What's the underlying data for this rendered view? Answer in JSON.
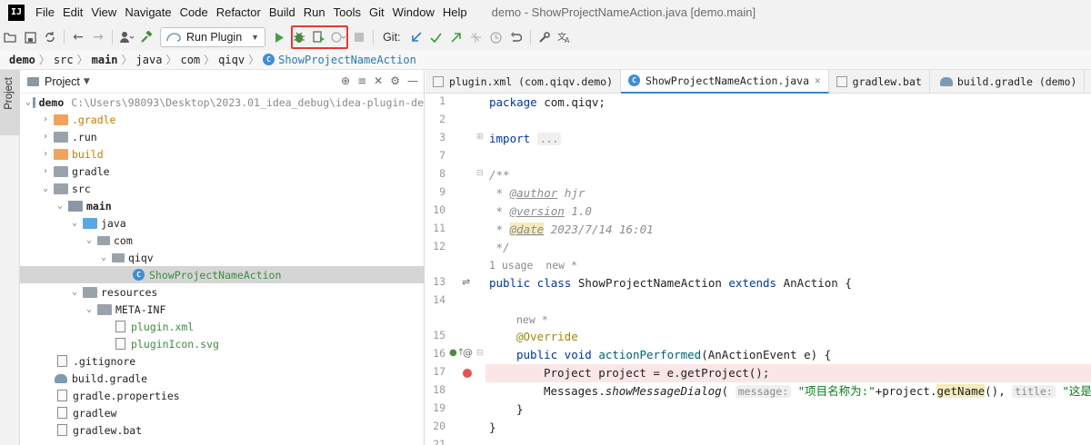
{
  "app": {
    "logo": "IJ",
    "window_title": "demo - ShowProjectNameAction.java [demo.main]"
  },
  "menu": [
    "File",
    "Edit",
    "View",
    "Navigate",
    "Code",
    "Refactor",
    "Build",
    "Run",
    "Tools",
    "Git",
    "Window",
    "Help"
  ],
  "toolbar": {
    "run_config": "Run Plugin",
    "git_label": "Git:"
  },
  "breadcrumbs": [
    "demo",
    "src",
    "main",
    "java",
    "com",
    "qiqv",
    "ShowProjectNameAction"
  ],
  "side_tab": "Project",
  "project_panel": {
    "title": "Project",
    "tree": [
      {
        "label": "demo",
        "hint": "C:\\Users\\98093\\Desktop\\2023.01_idea_debug\\idea-plugin-de"
      },
      {
        "label": ".gradle"
      },
      {
        "label": ".run"
      },
      {
        "label": "build"
      },
      {
        "label": "gradle"
      },
      {
        "label": "src"
      },
      {
        "label": "main"
      },
      {
        "label": "java"
      },
      {
        "label": "com"
      },
      {
        "label": "qiqv"
      },
      {
        "label": "ShowProjectNameAction"
      },
      {
        "label": "resources"
      },
      {
        "label": "META-INF"
      },
      {
        "label": "plugin.xml"
      },
      {
        "label": "pluginIcon.svg"
      },
      {
        "label": ".gitignore"
      },
      {
        "label": "build.gradle"
      },
      {
        "label": "gradle.properties"
      },
      {
        "label": "gradlew"
      },
      {
        "label": "gradlew.bat"
      }
    ]
  },
  "editor": {
    "tabs": [
      "plugin.xml (com.qiqv.demo)",
      "ShowProjectNameAction.java",
      "gradlew.bat",
      "build.gradle (demo)"
    ],
    "line_numbers": [
      "1",
      "2",
      "3",
      "7",
      "8",
      "9",
      "10",
      "11",
      "12",
      "13",
      "14",
      "15",
      "16",
      "17",
      "18",
      "19",
      "20",
      "21"
    ],
    "code": {
      "package_kw": "package",
      "package_name": " com.qiqv;",
      "import_kw": "import",
      "import_fold": "...",
      "doc_open": "/**",
      "author_tag": "@author",
      "author_val": " hjr",
      "version_tag": "@version",
      "version_val": " 1.0",
      "date_tag": "@date",
      "date_val": " 2023/7/14 16:01",
      "doc_close": " */",
      "usage_hint": "1 usage  new *",
      "class_kw": "public class",
      "class_name": " ShowProjectNameAction ",
      "extends_kw": "extends",
      "super_name": " AnAction {",
      "new_hint": "new *",
      "override": "@Override",
      "method_kw": "public void",
      "method_name": "actionPerformed",
      "method_sig": "(AnActionEvent e) {",
      "line17": "Project project = e.getProject();",
      "line18_a": "Messages.",
      "line18_b": "showMessageDialog",
      "line18_c": "(",
      "param_message": "message:",
      "line18_str1": "\"项目名称为:\"",
      "line18_d": "+project.",
      "line18_getname": "getName",
      "line18_e": "(),",
      "param_title": "title:",
      "line18_str2": "\"这是",
      "close_brace_inner": "}",
      "close_brace_outer": "}"
    }
  }
}
